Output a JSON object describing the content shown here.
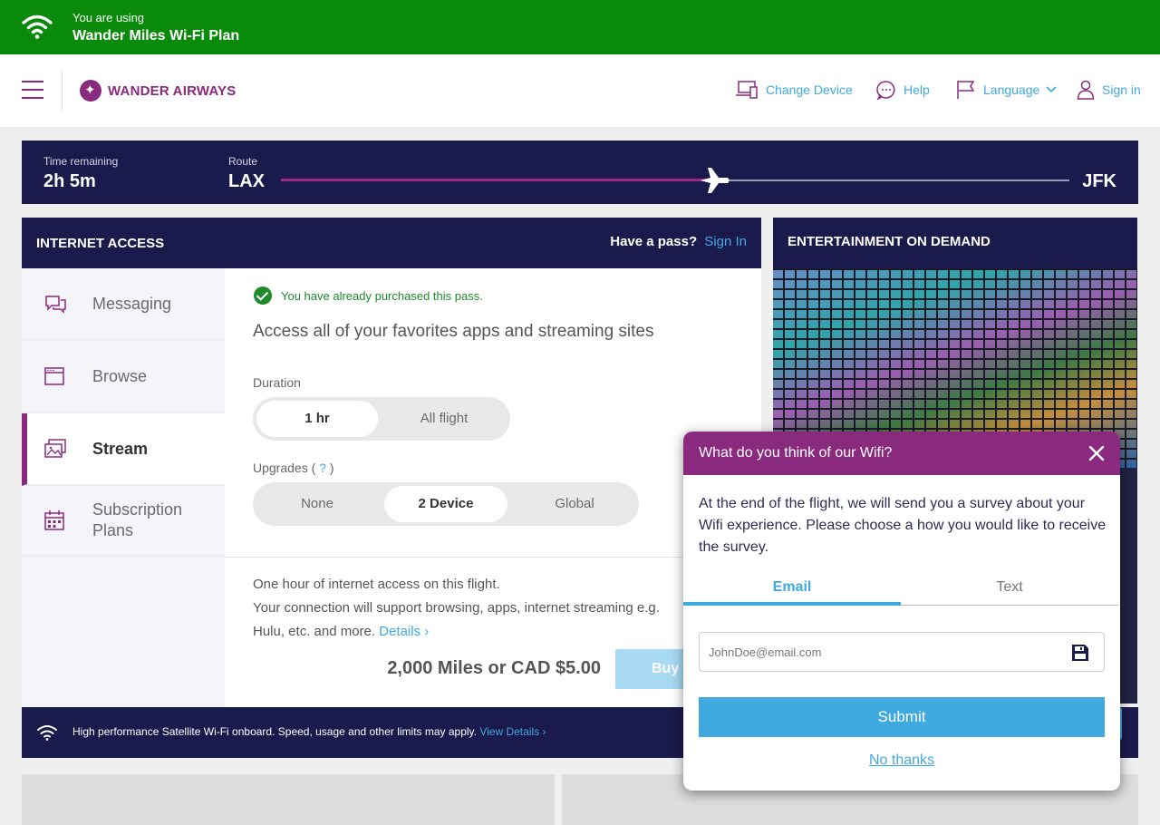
{
  "banner": {
    "line1": "You are using",
    "line2": "Wander Miles Wi-Fi Plan",
    "icon": "wifi-icon"
  },
  "header": {
    "brand": "WANDER AIRWAYS",
    "nav": {
      "change_device": "Change Device",
      "help": "Help",
      "language": "Language",
      "sign_in": "Sign in"
    }
  },
  "route": {
    "time_label": "Time remaining",
    "time_value": "2h 5m",
    "route_label": "Route",
    "origin": "LAX",
    "destination": "JFK",
    "progress": 0.55
  },
  "internet": {
    "title": "INTERNET ACCESS",
    "pass_text": "Have a pass?",
    "pass_link": "Sign In",
    "sidebar": [
      {
        "label": "Messaging",
        "icon": "chat-icon"
      },
      {
        "label": "Browse",
        "icon": "browser-icon"
      },
      {
        "label": "Stream",
        "icon": "gallery-icon",
        "active": true
      },
      {
        "label": "Subscription\nPlans",
        "icon": "calendar-icon"
      }
    ],
    "purchased": "You have already purchased this pass.",
    "headline": "Access all of your favorites apps and streaming sites",
    "duration_label": "Duration",
    "duration_options": [
      "1 hr",
      "All flight"
    ],
    "duration_selected": "1 hr",
    "upgrades_label": "Upgrades (",
    "upgrades_q": "?",
    "upgrades_close": ")",
    "upgrade_options": [
      "None",
      "2 Device",
      "Global"
    ],
    "upgrade_selected": "2 Device",
    "desc_line1": "One hour of internet access on this flight.",
    "desc_line2": "Your connection will support browsing, apps, internet streaming e.g.",
    "desc_line3": "Hulu, etc. and more.",
    "details_link": "Details ›",
    "price": "2,000 Miles or CAD $5.00",
    "buy_label": "Buy N"
  },
  "entertainment": {
    "title": "ENTERTAINMENT ON DEMAND"
  },
  "footer": {
    "text": "High performance Satellite Wi-Fi onboard. Speed, usage and other limits may apply.",
    "link": "View Details ›"
  },
  "survey": {
    "title": "What do you think of our Wifi?",
    "body": "At the end of the flight, we will send you a survey about your Wifi experience. Please choose a how you would like to receive the survey.",
    "tabs": [
      "Email",
      "Text"
    ],
    "active_tab": "Email",
    "email_placeholder": "JohnDoe@email.com",
    "email_value": "",
    "submit": "Submit",
    "decline": "No thanks"
  },
  "colors": {
    "green": "#0a8a0a",
    "navy": "#1b1a4c",
    "purple": "#8a2a7e",
    "blue": "#3fa9e0"
  }
}
